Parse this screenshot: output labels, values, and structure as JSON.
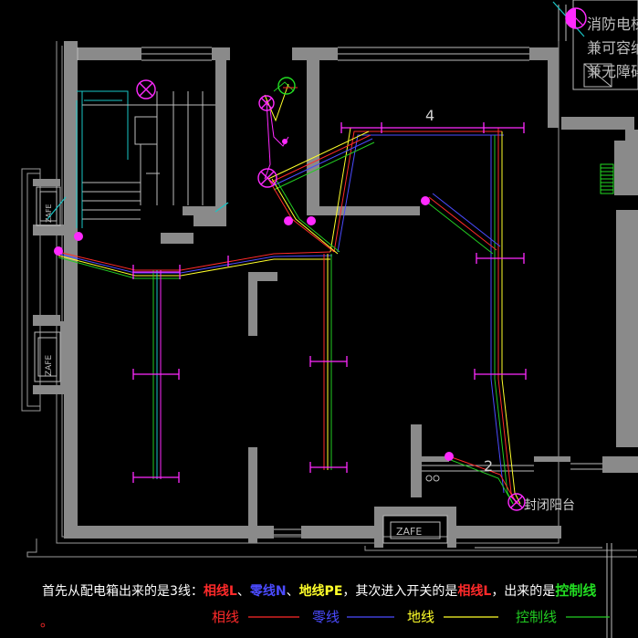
{
  "labels": {
    "fire_elevator_lines": [
      "消防电梯",
      "兼可容纳",
      "兼无障碍"
    ],
    "elec_box": "ZAFE",
    "route_4": "4",
    "route_2": "2",
    "balcony": "封闭阳台"
  },
  "caption": {
    "prefix": "首先从配电箱出来的是3线：",
    "phase": "相线L",
    "sep1": "、",
    "neutral": "零线N",
    "sep2": "、",
    "ground": "地线PE",
    "mid": "，其次进入开关的是",
    "switch_phase": "相线L",
    "mid2": "，出来的是",
    "control": "控制线",
    "end": "。"
  },
  "legend": [
    {
      "label": "相线",
      "color": "#ff2a2a"
    },
    {
      "label": "零线",
      "color": "#4b4bff"
    },
    {
      "label": "地线",
      "color": "#ffff2a"
    },
    {
      "label": "控制线",
      "color": "#22cc22"
    }
  ]
}
